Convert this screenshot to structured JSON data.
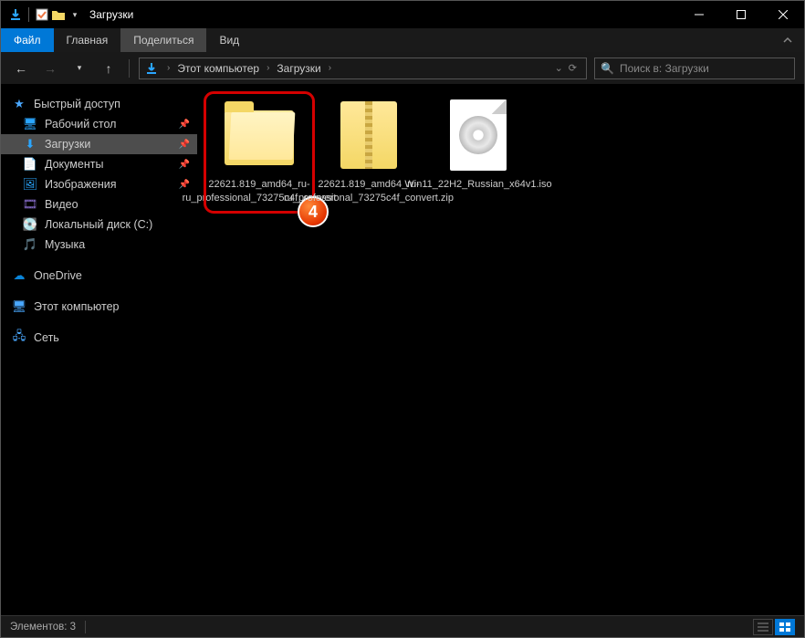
{
  "title": "Загрузки",
  "ribbon": {
    "file": "Файл",
    "home": "Главная",
    "share": "Поделиться",
    "view": "Вид"
  },
  "breadcrumb": {
    "root": "Этот компьютер",
    "folder": "Загрузки"
  },
  "search": {
    "placeholder": "Поиск в: Загрузки"
  },
  "sidebar": {
    "quick": {
      "label": "Быстрый доступ",
      "items": [
        {
          "label": "Рабочий стол",
          "icon": "desktop",
          "pin": true
        },
        {
          "label": "Загрузки",
          "icon": "download",
          "pin": true,
          "selected": true
        },
        {
          "label": "Документы",
          "icon": "docs",
          "pin": true
        },
        {
          "label": "Изображения",
          "icon": "pics",
          "pin": true
        },
        {
          "label": "Видео",
          "icon": "video"
        },
        {
          "label": "Локальный диск (C:)",
          "icon": "disk"
        },
        {
          "label": "Музыка",
          "icon": "music"
        }
      ]
    },
    "onedrive": {
      "label": "OneDrive"
    },
    "thispc": {
      "label": "Этот компьютер"
    },
    "network": {
      "label": "Сеть"
    }
  },
  "files": [
    {
      "name": "22621.819_amd64_ru-ru_professional_73275c4f_convert",
      "type": "folder",
      "highlight": true
    },
    {
      "name": "22621.819_amd64_ru-ru_professional_73275c4f_convert.zip",
      "type": "zip"
    },
    {
      "name": "Win11_22H2_Russian_x64v1.iso",
      "type": "iso"
    }
  ],
  "badge": "4",
  "status": {
    "items": "Элементов: 3"
  }
}
